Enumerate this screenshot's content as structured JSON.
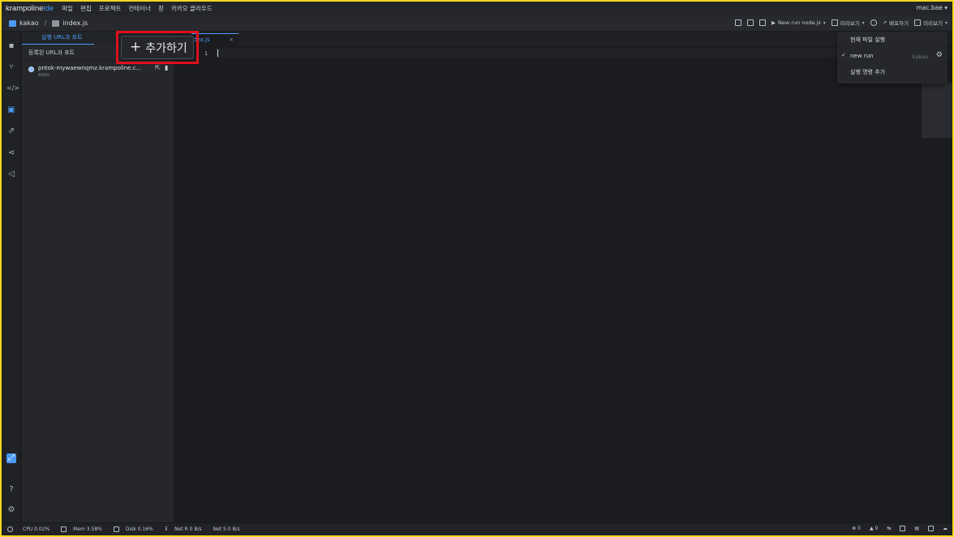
{
  "menubar": {
    "brand_main": "krampoline",
    "brand_ide": "ide",
    "items": [
      "파일",
      "편집",
      "프로젝트",
      "컨테이너",
      "창",
      "카카오 클라우드"
    ],
    "user": "mac.bae ▾"
  },
  "toolbar": {
    "project": "kakao",
    "separator": "/",
    "file": "index.js",
    "run_button": "New run node.js",
    "preview_button": "미리보기",
    "deploy_button": "배포하기",
    "preview_button_2": "미리보기"
  },
  "panel": {
    "tab_label": "실행 URL과 포트",
    "header": "등록된 URL과 포트",
    "url_text": "pntok-mywaewnqmz.krampoline.c...",
    "url_port": "8080"
  },
  "editor": {
    "tab_label": "dex.js",
    "tab_close": "×",
    "line_number": "1"
  },
  "add_popup": {
    "plus": "+",
    "label": "추가하기"
  },
  "run_menu": {
    "items": [
      {
        "label": "현재 파일 실행"
      },
      {
        "label": "new run",
        "meta": "kakao",
        "check": "✓"
      },
      {
        "label": "실행 명령 추가"
      }
    ]
  },
  "statusbar": {
    "cpu": "CPU 0.02%",
    "mem": "Mem 3.58%",
    "disk": "Disk 0.16%",
    "net_r": "Net R 0 B/s",
    "net_s": "Net S 0 B/s",
    "errors": "0",
    "warnings": "0"
  },
  "colors": {
    "accent": "#4b9bf7",
    "highlight_border": "#e0101b",
    "outer_frame": "#f7d81c"
  }
}
